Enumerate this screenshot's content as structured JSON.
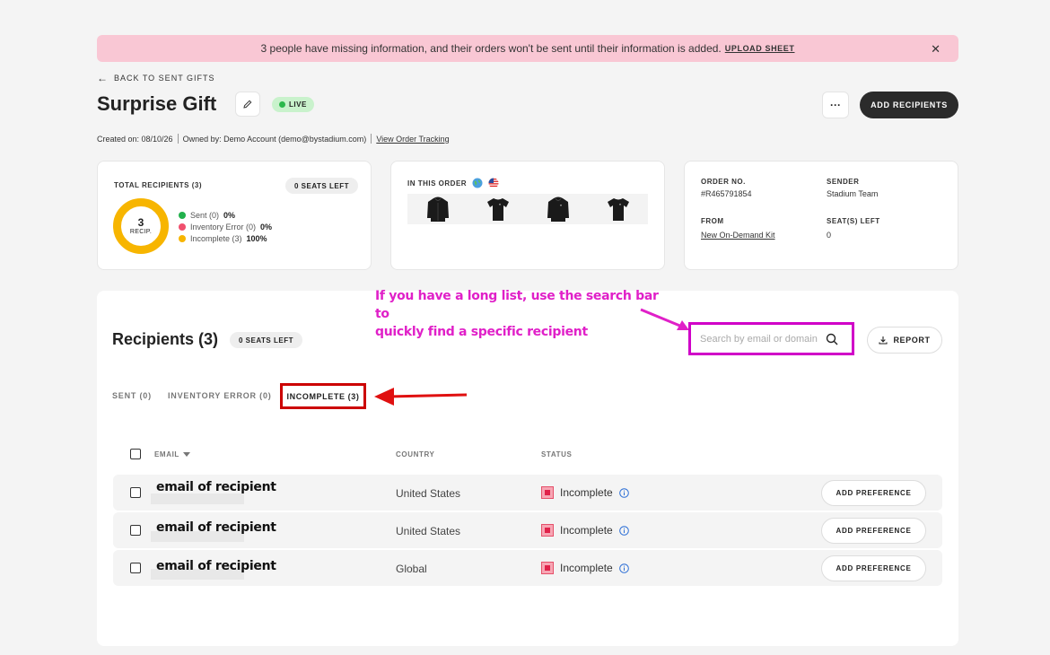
{
  "banner": {
    "message": "3 people have missing information, and their orders won't be sent until their information is added.",
    "link": "UPLOAD SHEET",
    "close": "✕"
  },
  "nav": {
    "back_label": "BACK TO SENT GIFTS"
  },
  "header": {
    "title": "Surprise Gift",
    "status_badge": "LIVE",
    "more_label": "···",
    "add_recipients_label": "ADD RECIPIENTS"
  },
  "meta": {
    "created": "Created on: 08/10/26",
    "owned": "Owned by: Demo Account (demo@bystadium.com)",
    "tracking_link": "View Order Tracking"
  },
  "summary": {
    "total_label": "TOTAL RECIPIENTS (3)",
    "seats_left_pill": "0 SEATS LEFT",
    "donut_count": "3",
    "donut_label": "RECIP.",
    "legend": [
      {
        "label": "Sent (0)",
        "pct": "0%",
        "color": "#22b14c"
      },
      {
        "label": "Inventory Error (0)",
        "pct": "0%",
        "color": "#f0506e"
      },
      {
        "label": "Incomplete (3)",
        "pct": "100%",
        "color": "#f7b500"
      }
    ],
    "incomplete_fraction": 1.0
  },
  "order_items": {
    "label": "IN THIS ORDER",
    "flags": [
      "globe-icon",
      "us-flag-icon"
    ],
    "products": [
      "hoodie-icon",
      "tshirt-icon",
      "hoodie-icon",
      "tshirt-icon"
    ]
  },
  "order_info": {
    "order_no_label": "ORDER NO.",
    "order_no": "#R465791854",
    "sender_label": "SENDER",
    "sender": "Stadium Team",
    "from_label": "FROM",
    "from": "New On-Demand Kit",
    "seats_label": "SEAT(S) LEFT",
    "seats": "0"
  },
  "annotation": {
    "line1": "If you have a long list, use the search bar to",
    "line2": "quickly find a specific recipient",
    "color": "#e020c8"
  },
  "recipients": {
    "title": "Recipients (3)",
    "seats_left_pill": "0 SEATS LEFT",
    "search_placeholder": "Search by email or domain",
    "report_label": "REPORT",
    "tabs": [
      {
        "label": "SENT (0)"
      },
      {
        "label": "INVENTORY ERROR (0)"
      },
      {
        "label": "INCOMPLETE (3)",
        "active": true
      }
    ],
    "columns": {
      "email": "EMAIL",
      "country": "COUNTRY",
      "status": "STATUS"
    },
    "rows": [
      {
        "email": "email of recipient",
        "country": "United States",
        "status": "Incomplete",
        "action": "ADD PREFERENCE"
      },
      {
        "email": "email of recipient",
        "country": "United States",
        "status": "Incomplete",
        "action": "ADD PREFERENCE"
      },
      {
        "email": "email of recipient",
        "country": "Global",
        "status": "Incomplete",
        "action": "ADD PREFERENCE"
      }
    ]
  }
}
